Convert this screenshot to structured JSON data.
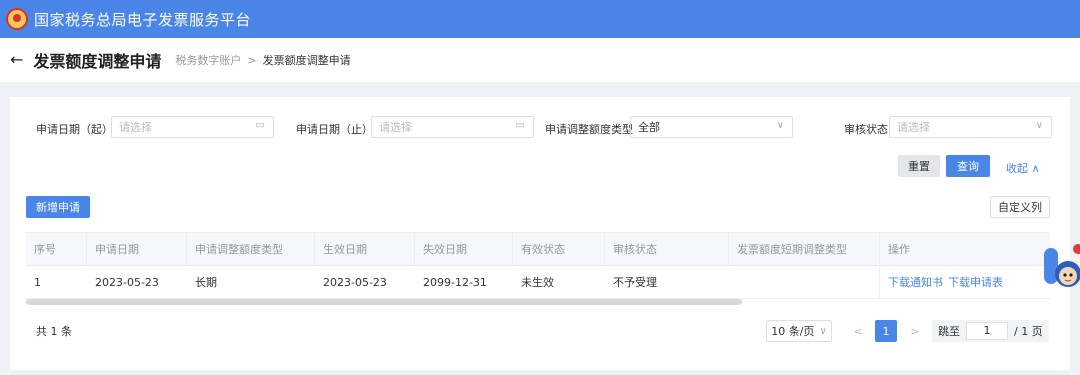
{
  "app": {
    "title": "国家税务总局电子发票服务平台"
  },
  "header": {
    "page_title": "发票额度调整申请",
    "breadcrumb": [
      "税务数字账户",
      "发票额度调整申请"
    ],
    "crumb_sep": ">",
    "back_glyph": "←"
  },
  "filters": {
    "start_date": {
      "label": "申请日期（起）",
      "placeholder": "请选择",
      "icon": "calendar-icon"
    },
    "end_date": {
      "label": "申请日期（止）",
      "placeholder": "请选择",
      "icon": "calendar-icon"
    },
    "adjust_type": {
      "label": "申请调整额度类型",
      "value": "全部",
      "icon": "chevron-down-icon"
    },
    "review_status": {
      "label": "审核状态",
      "placeholder": "请选择",
      "icon": "chevron-down-icon"
    },
    "reset_label": "重置",
    "query_label": "查询",
    "collapse_label": "收起",
    "collapse_glyph": "∧"
  },
  "toolbar": {
    "add_label": "新增申请",
    "custom_cols_label": "自定义列"
  },
  "table": {
    "columns": [
      "序号",
      "申请日期",
      "申请调整额度类型",
      "生效日期",
      "失效日期",
      "有效状态",
      "审核状态",
      "发票额度短期调整类型",
      "操作"
    ],
    "rows": [
      {
        "cells": [
          "1",
          "2023-05-23",
          "长期",
          "2023-05-23",
          "2099-12-31",
          "未生效",
          "不予受理",
          ""
        ],
        "actions": [
          "下载通知书",
          "下载申请表"
        ]
      }
    ]
  },
  "pagination": {
    "total": "共 1 条",
    "page_size": "10 条/页",
    "page_size_glyph": "∨",
    "prev_glyph": "<",
    "current_page": "1",
    "next_glyph": ">",
    "jump_label": "跳至",
    "jump_value": "1",
    "page_count": "/ 1 页"
  },
  "colors": {
    "brand": "#4a86e8",
    "header_bg": "#4a86e8",
    "emblem_red": "#d8322b",
    "emblem_gold": "#f6c75a"
  }
}
